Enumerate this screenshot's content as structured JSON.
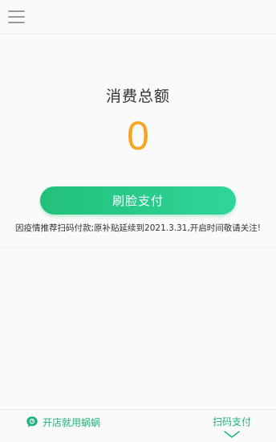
{
  "main": {
    "total_label": "消费总额",
    "total_value": "0",
    "face_pay_label": "刷脸支付",
    "notice": "因疫情推荐扫码付款;原补贴延续到2021.3.31,开启时间敬请关注!"
  },
  "bottom": {
    "promo_label": "开店就用蜗蜗",
    "scan_pay_label": "扫码支付"
  },
  "icons": {
    "menu": "menu-icon",
    "promo": "chat-bubble-icon",
    "chevron": "chevron-down-icon"
  },
  "colors": {
    "accent_green": "#23c07a",
    "amount_orange": "#f5a623",
    "link_green": "#1fb47a"
  }
}
